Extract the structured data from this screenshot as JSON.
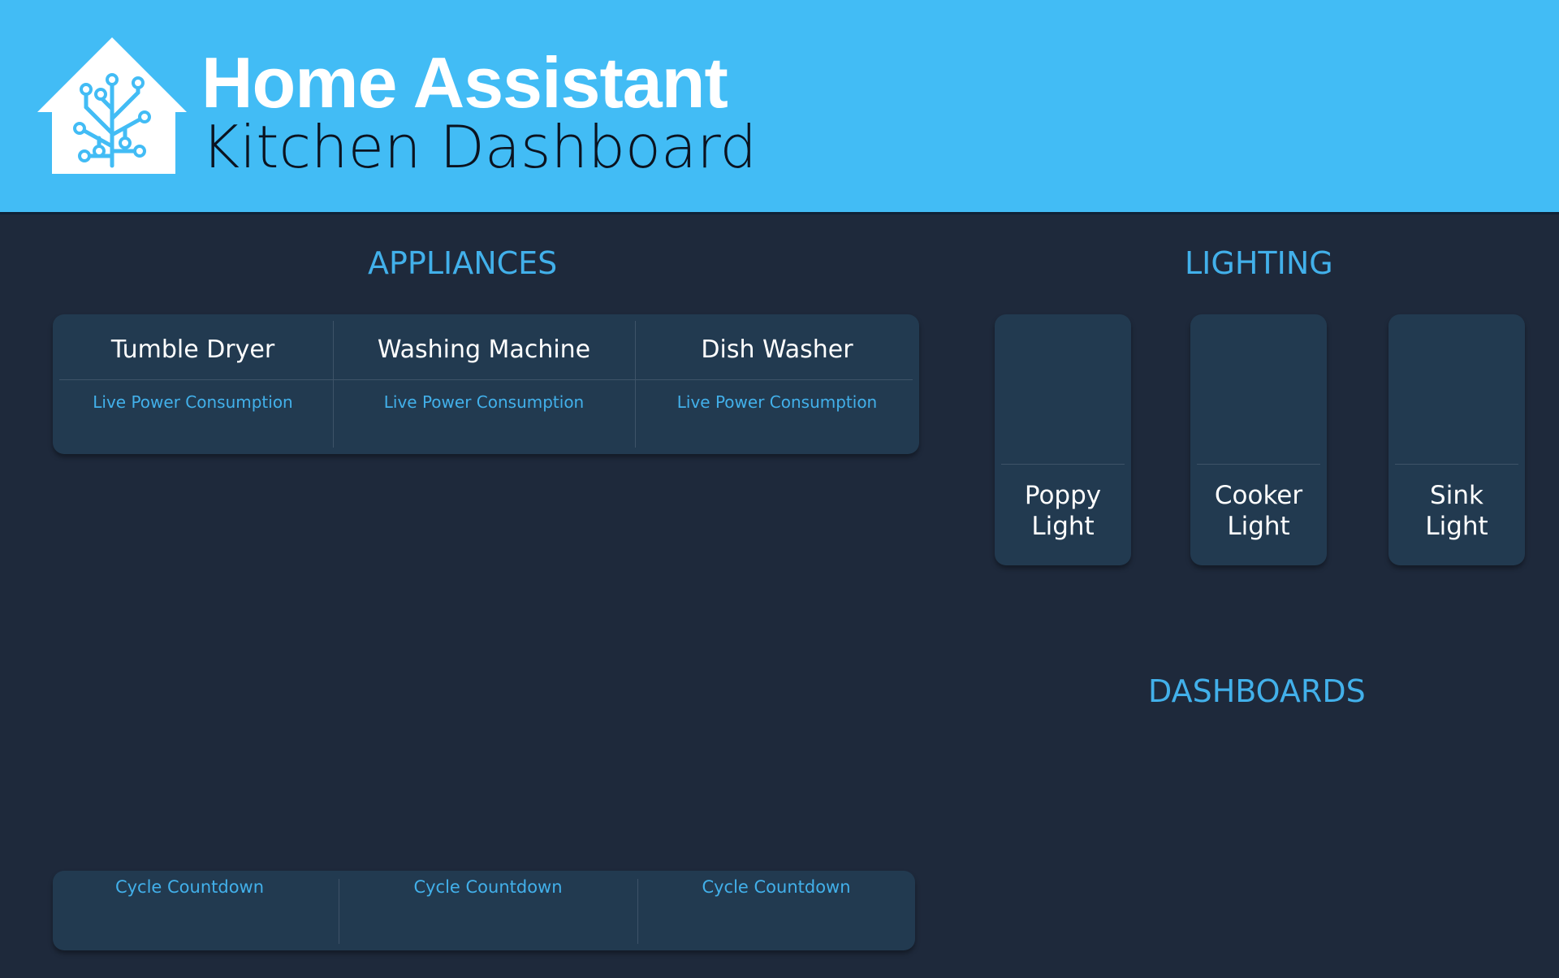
{
  "header": {
    "app_title": "Home Assistant",
    "dashboard_title": "Kitchen Dashboard",
    "logo_icon": "home-assistant-logo-icon",
    "background_color": "#42bcf5"
  },
  "sections": {
    "appliances": "APPLIANCES",
    "lighting": "LIGHTING",
    "dashboards": "DASHBOARDS"
  },
  "appliances": [
    {
      "name": "Tumble Dryer",
      "power_label": "Live Power Consumption"
    },
    {
      "name": "Washing Machine",
      "power_label": "Live Power Consumption"
    },
    {
      "name": "Dish Washer",
      "power_label": "Live Power Consumption"
    }
  ],
  "countdowns": [
    {
      "label": "Cycle Countdown"
    },
    {
      "label": "Cycle Countdown"
    },
    {
      "label": "Cycle Countdown"
    }
  ],
  "lights": [
    {
      "line1": "Poppy",
      "line2": "Light"
    },
    {
      "line1": "Cooker",
      "line2": "Light"
    },
    {
      "line1": "Sink",
      "line2": "Light"
    }
  ],
  "colors": {
    "page_background": "#1e293b",
    "card_background": "#223a50",
    "accent": "#42b0ea",
    "text": "#ffffff"
  }
}
